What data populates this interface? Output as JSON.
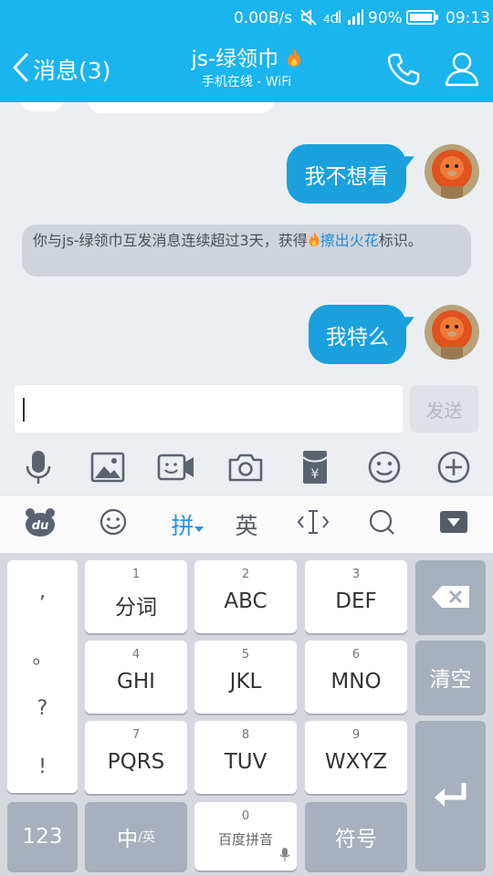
{
  "status": {
    "speed": "0.00B/s",
    "battery": "90%",
    "time": "09:13"
  },
  "header": {
    "back_label": "消息(3)",
    "title": "js-绿领巾",
    "subtitle": "手机在线 - WiFi"
  },
  "messages": [
    {
      "text": "我不想看"
    },
    {
      "text": "我特么"
    }
  ],
  "system_notice": {
    "prefix": "你与js-绿领巾互发消息连续超过3天，获得",
    "link": "擦出火花",
    "suffix": "标识。"
  },
  "input": {
    "value": "",
    "send_label": "发送"
  },
  "ime_bar": {
    "pinyin": "拼",
    "english": "英"
  },
  "keyboard": {
    "punct": [
      ",",
      "。",
      "?",
      "!"
    ],
    "keys": [
      {
        "num": "1",
        "label": "分词"
      },
      {
        "num": "2",
        "label": "ABC"
      },
      {
        "num": "3",
        "label": "DEF"
      },
      {
        "num": "4",
        "label": "GHI"
      },
      {
        "num": "5",
        "label": "JKL"
      },
      {
        "num": "6",
        "label": "MNO"
      },
      {
        "num": "7",
        "label": "PQRS"
      },
      {
        "num": "8",
        "label": "TUV"
      },
      {
        "num": "9",
        "label": "WXYZ"
      }
    ],
    "clear_label": "清空",
    "num_label": "123",
    "zh_label": "中",
    "en_small": "/英",
    "space_num": "0",
    "space_label": "百度拼音",
    "symbol_label": "符号"
  },
  "colors": {
    "header_blue": "#1ab4ee",
    "bubble_blue": "#1aa0dd",
    "link": "#1a8fd8",
    "ime_active": "#2d8fe0"
  }
}
